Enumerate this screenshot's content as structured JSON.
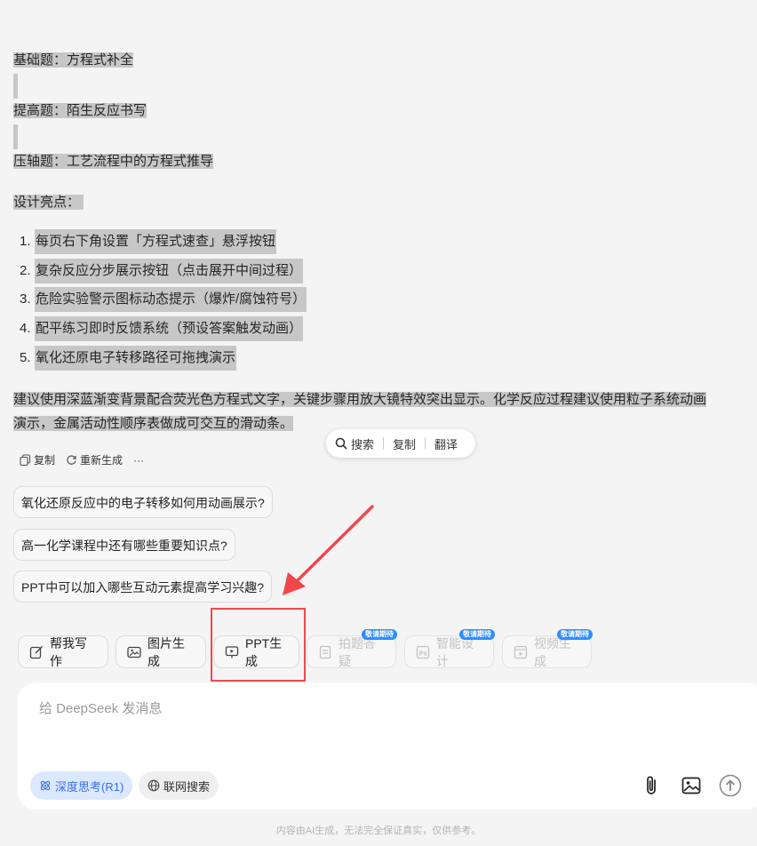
{
  "content": {
    "lines": [
      "基础题：方程式补全",
      "提高题：陌生反应书写",
      "压轴题：工艺流程中的方程式推导"
    ],
    "design_title": "设计亮点：",
    "list": [
      "每页右下角设置「方程式速查」悬浮按钮",
      "复杂反应分步展示按钮（点击展开中间过程）",
      "危险实验警示图标动态提示（爆炸/腐蚀符号）",
      "配平练习即时反馈系统（预设答案触发动画）",
      "氧化还原电子转移路径可拖拽演示"
    ],
    "para_line1": "建议使用深蓝渐变背景配合荧光色方程式文字，关键步骤用放大镜特效突出显示。化学反应过程建议使用粒子系统动画",
    "para_line2": "演示，金属活动性顺序表做成可交互的滑动条。"
  },
  "selection_popup": {
    "search": "搜索",
    "copy": "复制",
    "translate": "翻译"
  },
  "message_actions": {
    "copy": "复制",
    "regenerate": "重新生成",
    "more": "···"
  },
  "suggestions": [
    "氧化还原反应中的电子转移如何用动画展示?",
    "高一化学课程中还有哪些重要知识点?",
    "PPT中可以加入哪些互动元素提高学习兴趣?"
  ],
  "tools": {
    "write": "帮我写作",
    "image": "图片生成",
    "ppt": "PPT生成",
    "photo": "拍题答疑",
    "design": "智能设计",
    "video": "视频生成",
    "badge": "敬请期待"
  },
  "input": {
    "placeholder": "给 DeepSeek 发消息",
    "deep_think": "深度思考(R1)",
    "web_search": "联网搜索"
  },
  "footer": "内容由AI生成，无法完全保证真实，仅供参考。",
  "colors": {
    "highlight": "#c7c7c7",
    "accent": "#3a6ff0",
    "annotation": "#f0474b",
    "badge": "#2f8cff"
  }
}
